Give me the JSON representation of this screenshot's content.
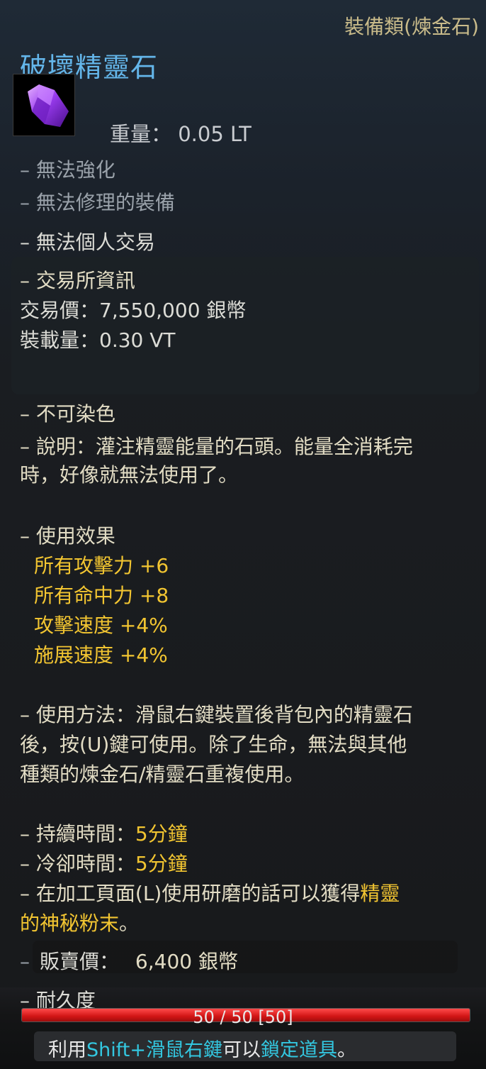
{
  "item": {
    "category": "裝備類(煉金石)",
    "name": "破壞精靈石",
    "icon": "purple-crystal-icon",
    "weight": "重量： 0.05 LT"
  },
  "restrictions": [
    "– 無法強化",
    "– 無法修理的裝備",
    "– 無法個人交易"
  ],
  "market": {
    "heading": "– 交易所資訊",
    "price": "交易價：7,550,000 銀幣",
    "load": "裝載量：0.30 VT"
  },
  "dye": "– 不可染色",
  "description": {
    "line1": "– 說明：灌注精靈能量的石頭。能量全消耗完",
    "line2": "時，好像就無法使用了。"
  },
  "effects": {
    "heading": "– 使用效果",
    "items": [
      "所有攻擊力 +6",
      "所有命中力 +8",
      "攻擊速度 +4%",
      "施展速度 +4%"
    ]
  },
  "usage": {
    "line1": "– 使用方法：滑鼠右鍵裝置後背包內的精靈石",
    "line2": "後，按(U)鍵可使用。除了生命，無法與其他",
    "line3": "種類的煉金石/精靈石重複使用。"
  },
  "duration": {
    "label": "– 持續時間：",
    "value": "5分鐘"
  },
  "cooldown": {
    "label": "– 冷卻時間：",
    "value": "5分鐘"
  },
  "grind": {
    "line1_prefix": "– 在加工頁面(L)使用研磨的話可以獲得",
    "line1_highlight": "精靈",
    "line2_highlight": "的神秘粉末",
    "line2_suffix": "。"
  },
  "sell": {
    "dash": "–",
    "label": "販賣價：",
    "value": "6,400 銀幣"
  },
  "durability": {
    "label": "– 耐久度",
    "text": "50 / 50 [50]",
    "fraction": 1.0
  },
  "hint": {
    "p1": "利用",
    "k1": "Shift+滑鼠右鍵",
    "p2": "可以",
    "k2": "鎖定道具",
    "p3": "。"
  },
  "colors": {
    "title": "#64b6ea",
    "gold": "#f2c531",
    "cyan": "#33c7e0",
    "bar_red": "#e02020"
  }
}
